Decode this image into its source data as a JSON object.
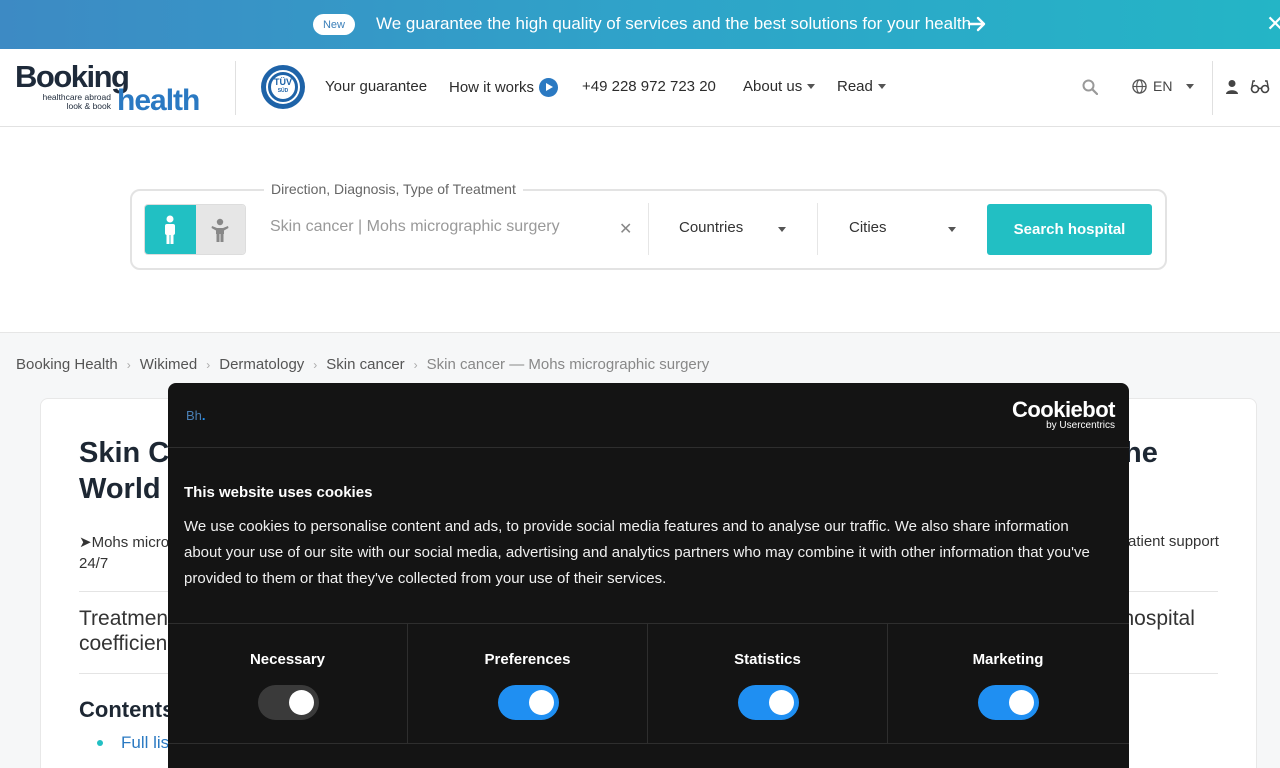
{
  "banner": {
    "badge": "New",
    "text": "We guarantee the high quality of services and the best solutions for your health",
    "accent": "#2fa3c9"
  },
  "header": {
    "logo": {
      "word1": "Booking",
      "tagline_line1": "healthcare abroad",
      "tagline_line2": "look & book",
      "word2": "health"
    },
    "tuv": {
      "top": "TÜV",
      "bottom": "SÜD"
    },
    "nav": {
      "guarantee": "Your guarantee",
      "how_it_works": "How it works",
      "phone": "+49 228 972 723 20",
      "about": "About us",
      "read": "Read"
    },
    "language": "EN"
  },
  "search": {
    "legend": "Direction, Diagnosis, Type of Treatment",
    "value": "Skin cancer | Mohs micrographic surgery",
    "clear": "✕",
    "countries": "Countries",
    "cities": "Cities",
    "button": "Search hospital",
    "accent": "#22bfc3"
  },
  "breadcrumb": {
    "items": [
      "Booking Health",
      "Wikimed",
      "Dermatology",
      "Skin cancer"
    ],
    "current": "Skin cancer — Mohs micrographic surgery"
  },
  "article": {
    "title_start": "Skin Ca",
    "title_line2": "World",
    "title_end": "he",
    "intro_start": "➤Mohs micro",
    "intro_line2": "24/7",
    "intro_end": "atient support",
    "treatment_start": "Treatmen",
    "treatment_line2": "coefficien",
    "treatment_end": "l hospital",
    "contents": "Contents",
    "list_link": "Full lis"
  },
  "cookie": {
    "brand_b": "Bh",
    "brand_dot": ".",
    "logo": "Cookiebot",
    "logo_sub": "by Usercentrics",
    "title": "This website uses cookies",
    "body": "We use cookies to personalise content and ads, to provide social media features and to analyse our traffic. We also share information about your use of our site with our social media, advertising and analytics partners who may combine it with other information that you've provided to them or that they've collected from your use of their services.",
    "categories": [
      {
        "label": "Necessary",
        "state": "locked"
      },
      {
        "label": "Preferences",
        "state": "on"
      },
      {
        "label": "Statistics",
        "state": "on"
      },
      {
        "label": "Marketing",
        "state": "on"
      }
    ],
    "toggle_color": "#1f8ff2"
  }
}
